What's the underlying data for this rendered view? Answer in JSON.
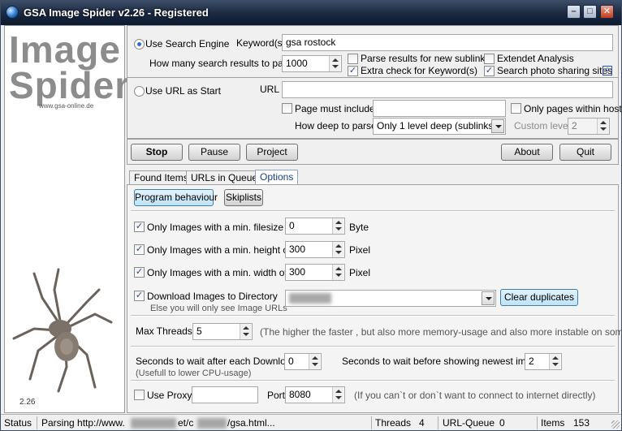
{
  "window": {
    "title": "GSA Image Spider v2.26 - Registered",
    "logo_line1": "Image",
    "logo_line2": "Spider",
    "logo_url": "www.gsa-online.de",
    "version": "2.26"
  },
  "search": {
    "use_search_engine_label": "Use Search Engine",
    "keywords_label": "Keyword(s)",
    "keywords_value": "gsa rostock",
    "results_label": "How many search results to parse",
    "results_value": "1000",
    "parse_new_sublinks_label": "Parse results for new sublinks",
    "extra_check_label": "Extra check for Keyword(s)",
    "extended_analysis_label": "Extendet Analysis",
    "search_photo_label": "Search photo sharing sites",
    "help_label": "?"
  },
  "url_start": {
    "use_url_label": "Use URL as Start",
    "url_label": "URL",
    "url_value": "",
    "page_must_include_label": "Page must include",
    "page_must_include_value": "",
    "only_pages_host_label": "Only pages within host",
    "depth_label": "How deep to parse",
    "depth_value": "Only 1 level deep (sublinks)",
    "custom_level_label": "Custom level",
    "custom_level_value": "2"
  },
  "toolbar": {
    "stop": "Stop",
    "pause": "Pause",
    "project": "Project",
    "about": "About",
    "quit": "Quit"
  },
  "tabs": [
    "Found Items",
    "URLs in Queue",
    "Options"
  ],
  "options": {
    "program_behaviour": "Program behaviour",
    "skiplists": "Skiplists",
    "min_filesize_label": "Only Images with a min. filesize of",
    "min_filesize_value": "0",
    "min_filesize_unit": "Byte",
    "min_height_label": "Only Images with a min. height of",
    "min_height_value": "300",
    "min_height_unit": "Pixel",
    "min_width_label": "Only Images with a min. width of",
    "min_width_value": "300",
    "min_width_unit": "Pixel",
    "download_label": "Download Images to Directory",
    "download_hint": "Else you will only see Image URLs",
    "clear_duplicates": "Clear duplicates",
    "max_threads_label": "Max Threads",
    "max_threads_value": "5",
    "max_threads_hint": "(The higher the faster , but also more memory-usage and also more instable on some PCs)",
    "wait_download_label": "Seconds to wait after each Download",
    "wait_download_value": "0",
    "wait_download_hint": "(Usefull to lower CPU-usage)",
    "wait_newest_label": "Seconds to wait before showing newest image",
    "wait_newest_value": "2",
    "use_proxy_label": "Use Proxy",
    "proxy_value": "",
    "port_label": "Port",
    "port_value": "8080",
    "proxy_hint": "(If you can`t or don`t want to connect to internet directly)"
  },
  "status": {
    "status_label": "Status",
    "parsing_prefix": "Parsing http://www.",
    "parsing_mid": "et/c",
    "parsing_suffix": "/gsa.html...",
    "threads_label": "Threads",
    "threads_value": "4",
    "queue_label": "URL-Queue",
    "queue_value": "0",
    "items_label": "Items",
    "items_value": "153"
  }
}
